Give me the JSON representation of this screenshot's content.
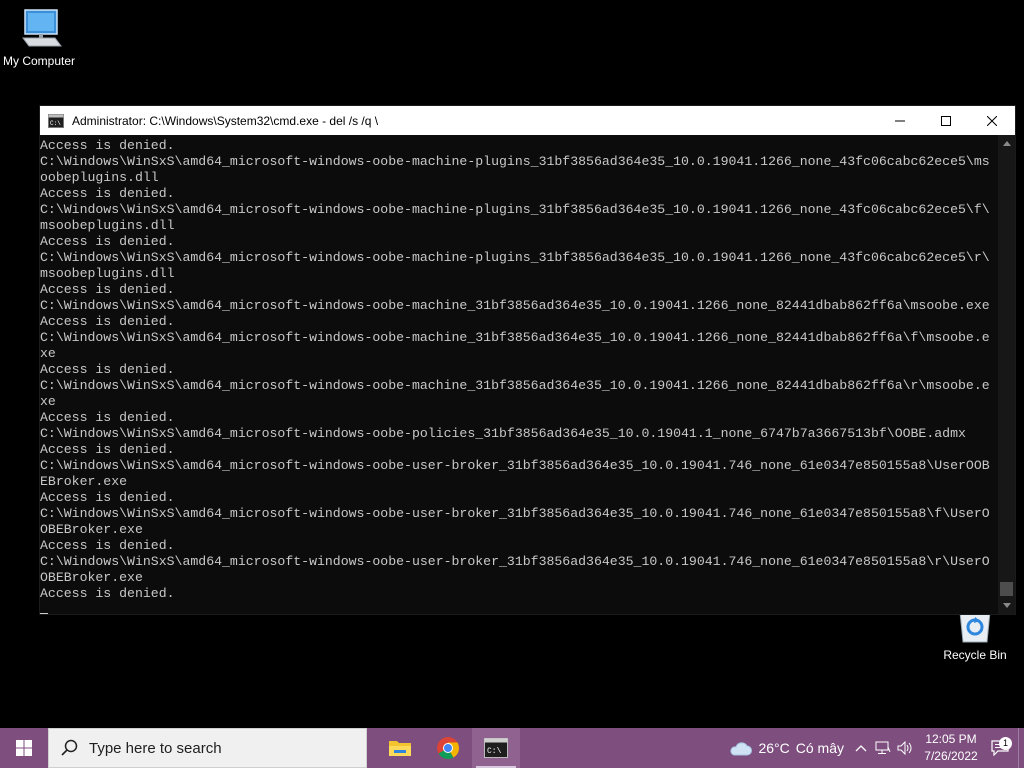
{
  "desktop": {
    "icons": [
      {
        "label": "My Computer",
        "icon": "computer-icon"
      },
      {
        "label": "Recycle Bin",
        "icon": "recycle-bin-icon"
      }
    ]
  },
  "window": {
    "title": "Administrator: C:\\Windows\\System32\\cmd.exe - del  /s /q \\",
    "controls": {
      "minimize": "minimize-icon",
      "maximize": "maximize-icon",
      "close": "close-icon"
    },
    "console_lines": [
      "Access is denied.",
      "C:\\Windows\\WinSxS\\amd64_microsoft-windows-oobe-machine-plugins_31bf3856ad364e35_10.0.19041.1266_none_43fc06cabc62ece5\\ms",
      "oobeplugins.dll",
      "Access is denied.",
      "C:\\Windows\\WinSxS\\amd64_microsoft-windows-oobe-machine-plugins_31bf3856ad364e35_10.0.19041.1266_none_43fc06cabc62ece5\\f\\",
      "msoobeplugins.dll",
      "Access is denied.",
      "C:\\Windows\\WinSxS\\amd64_microsoft-windows-oobe-machine-plugins_31bf3856ad364e35_10.0.19041.1266_none_43fc06cabc62ece5\\r\\",
      "msoobeplugins.dll",
      "Access is denied.",
      "C:\\Windows\\WinSxS\\amd64_microsoft-windows-oobe-machine_31bf3856ad364e35_10.0.19041.1266_none_82441dbab862ff6a\\msoobe.exe",
      "Access is denied.",
      "C:\\Windows\\WinSxS\\amd64_microsoft-windows-oobe-machine_31bf3856ad364e35_10.0.19041.1266_none_82441dbab862ff6a\\f\\msoobe.e",
      "xe",
      "Access is denied.",
      "C:\\Windows\\WinSxS\\amd64_microsoft-windows-oobe-machine_31bf3856ad364e35_10.0.19041.1266_none_82441dbab862ff6a\\r\\msoobe.e",
      "xe",
      "Access is denied.",
      "C:\\Windows\\WinSxS\\amd64_microsoft-windows-oobe-policies_31bf3856ad364e35_10.0.19041.1_none_6747b7a3667513bf\\OOBE.admx",
      "Access is denied.",
      "C:\\Windows\\WinSxS\\amd64_microsoft-windows-oobe-user-broker_31bf3856ad364e35_10.0.19041.746_none_61e0347e850155a8\\UserOOB",
      "EBroker.exe",
      "Access is denied.",
      "C:\\Windows\\WinSxS\\amd64_microsoft-windows-oobe-user-broker_31bf3856ad364e35_10.0.19041.746_none_61e0347e850155a8\\f\\UserO",
      "OBEBroker.exe",
      "Access is denied.",
      "C:\\Windows\\WinSxS\\amd64_microsoft-windows-oobe-user-broker_31bf3856ad364e35_10.0.19041.746_none_61e0347e850155a8\\r\\UserO",
      "OBEBroker.exe",
      "Access is denied."
    ]
  },
  "taskbar": {
    "search_placeholder": "Type here to search",
    "apps": [
      "file-explorer-icon",
      "chrome-icon",
      "command-prompt-icon"
    ],
    "weather": {
      "temp": "26°C",
      "desc": "Có mây"
    },
    "clock": {
      "time": "12:05 PM",
      "date": "7/26/2022"
    },
    "notifications_count": "1",
    "colors": {
      "taskbar": "#7d4e7e",
      "console_bg": "#0c0c0c",
      "console_text": "#c8c8c8"
    }
  }
}
